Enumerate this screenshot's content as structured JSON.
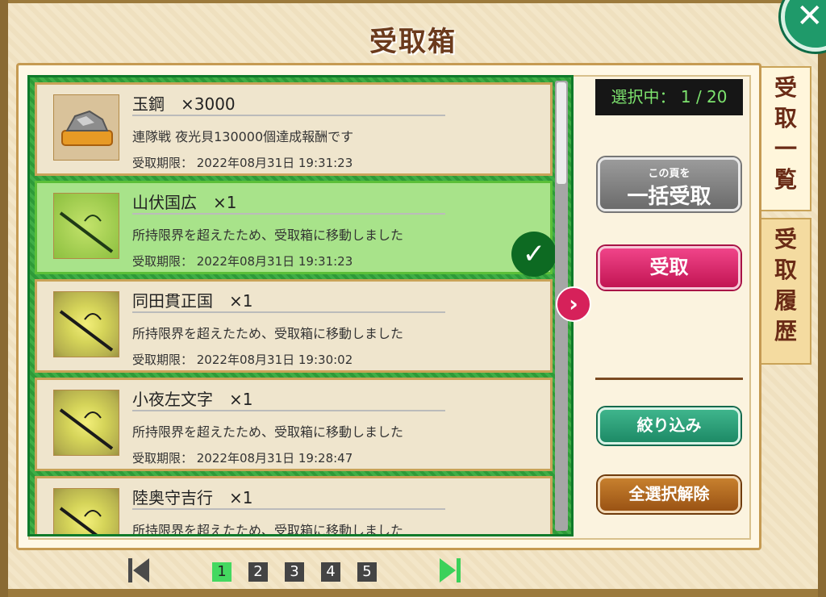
{
  "title": "受取箱",
  "counter": "選択中： 1 / 20",
  "buttons": {
    "bulk_small": "この頁を",
    "bulk_big": "一括受取",
    "receive": "受取",
    "filter": "絞り込み",
    "deselect_all": "全選択解除"
  },
  "tabs": [
    {
      "label": [
        "受",
        "取",
        "一",
        "覧"
      ]
    },
    {
      "label": [
        "受",
        "取",
        "履",
        "歴"
      ]
    }
  ],
  "items": [
    {
      "name": "玉鋼　×3000",
      "desc": "連隊戦 夜光貝130000個達成報酬です",
      "expiry": "受取期限： 2022年08月31日 19:31:23",
      "icon": "ore-icon",
      "selected": false
    },
    {
      "name": "山伏国広　×1",
      "desc": "所持限界を超えたため、受取箱に移動しました",
      "expiry": "受取期限： 2022年08月31日 19:31:23",
      "icon": "sword-icon",
      "selected": true
    },
    {
      "name": "同田貫正国　×1",
      "desc": "所持限界を超えたため、受取箱に移動しました",
      "expiry": "受取期限： 2022年08月31日 19:30:02",
      "icon": "sword-icon",
      "selected": false
    },
    {
      "name": "小夜左文字　×1",
      "desc": "所持限界を超えたため、受取箱に移動しました",
      "expiry": "受取期限： 2022年08月31日 19:28:47",
      "icon": "sword-icon",
      "selected": false
    },
    {
      "name": "陸奥守吉行　×1",
      "desc": "所持限界を超えたため、受取箱に移動しました",
      "expiry": "",
      "icon": "sword-icon",
      "selected": false
    }
  ],
  "pager": {
    "pages": [
      "1",
      "2",
      "3",
      "4",
      "5"
    ],
    "current": "1"
  },
  "colors": {
    "accent_green": "#3bd15a",
    "receive_pink": "#d6215a"
  }
}
